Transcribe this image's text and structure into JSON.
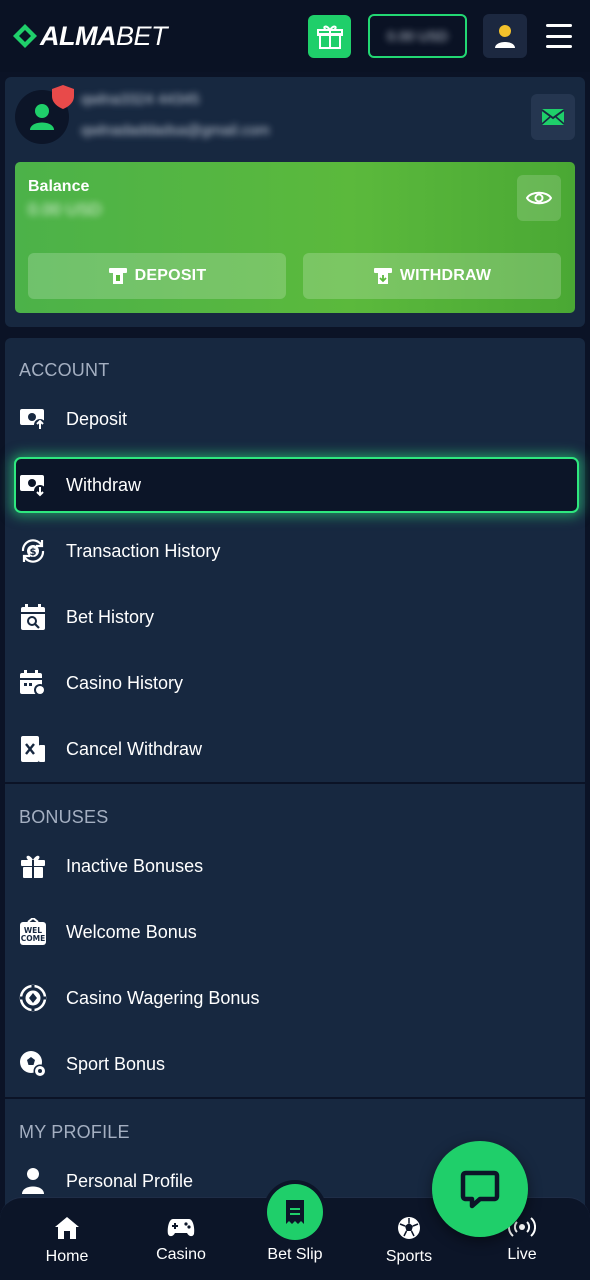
{
  "header": {
    "logo_bold": "ALMA",
    "logo_light": "BET",
    "balance_pill": "0.00 USD",
    "brand_color": "#1fcf6a"
  },
  "profile": {
    "name": "qwlna3324 44345",
    "email": "qwlnadaddadsa@gmail.com",
    "balance_label": "Balance",
    "balance_amount": "0.00 USD",
    "deposit_label": "DEPOSIT",
    "withdraw_label": "WITHDRAW"
  },
  "menu": {
    "account_title": "ACCOUNT",
    "account_items": [
      {
        "label": "Deposit",
        "icon": "cash-deposit-icon"
      },
      {
        "label": "Withdraw",
        "icon": "cash-withdraw-icon"
      },
      {
        "label": "Transaction History",
        "icon": "dollar-refresh-icon"
      },
      {
        "label": "Bet History",
        "icon": "calendar-search-icon"
      },
      {
        "label": "Casino History",
        "icon": "calendar-chip-icon"
      },
      {
        "label": "Cancel Withdraw",
        "icon": "cancel-cash-icon"
      }
    ],
    "bonuses_title": "BONUSES",
    "bonus_items": [
      {
        "label": "Inactive Bonuses",
        "icon": "gift-icon"
      },
      {
        "label": "Welcome Bonus",
        "icon": "welcome-badge-icon",
        "badge_top": "WEL",
        "badge_bottom": "COME"
      },
      {
        "label": "Casino Wagering Bonus",
        "icon": "casino-chip-icon"
      },
      {
        "label": "Sport Bonus",
        "icon": "soccer-ball-icon"
      }
    ],
    "profile_title": "MY PROFILE",
    "profile_items": [
      {
        "label": "Personal Profile",
        "icon": "person-icon"
      }
    ]
  },
  "bottom_nav": [
    {
      "label": "Home",
      "icon": "home-icon"
    },
    {
      "label": "Casino",
      "icon": "gamepad-icon"
    },
    {
      "label": "Bet Slip",
      "icon": "receipt-icon"
    },
    {
      "label": "Sports",
      "icon": "soccer-ball-icon"
    },
    {
      "label": "Live",
      "icon": "broadcast-icon"
    }
  ]
}
